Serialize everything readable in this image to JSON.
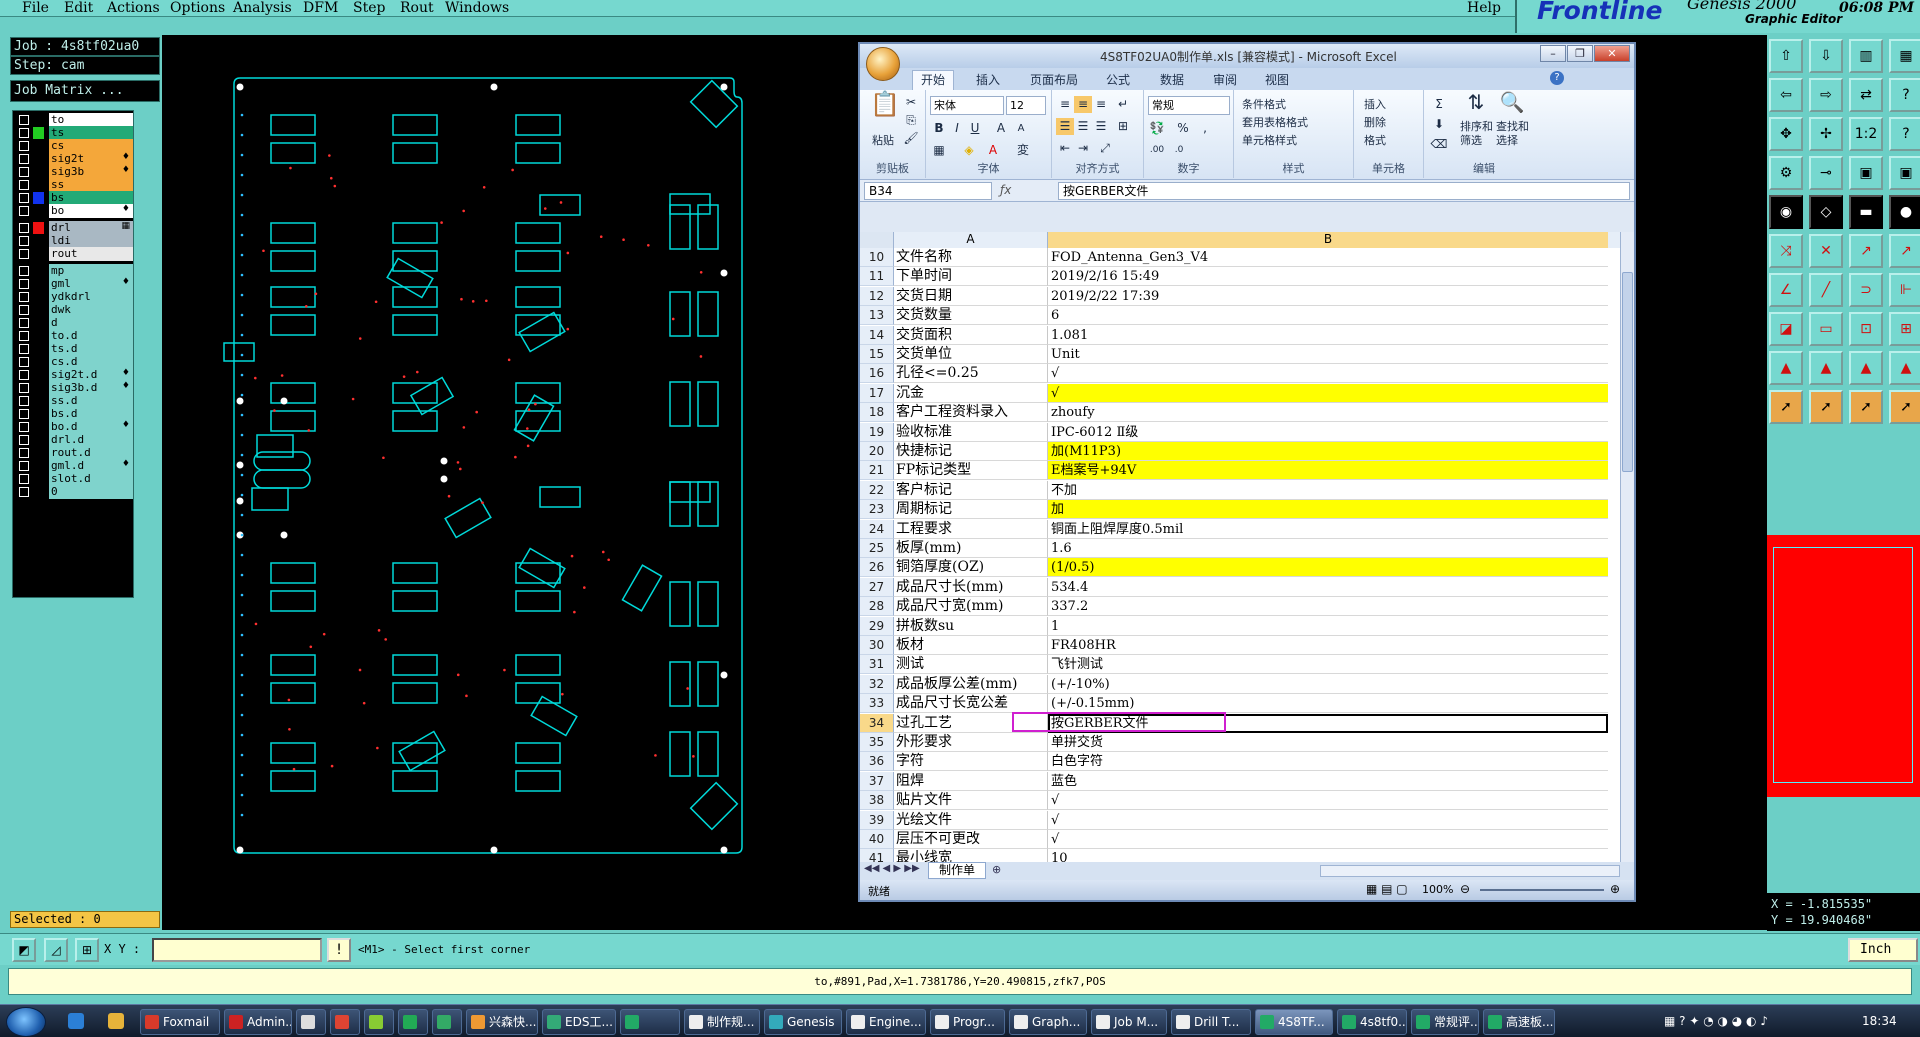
{
  "menubar": {
    "items": [
      "File",
      "Edit",
      "Actions",
      "Options",
      "Analysis",
      "DFM",
      "Step",
      "Rout",
      "Windows"
    ],
    "help": "Help"
  },
  "brand": {
    "logo": "Frontline",
    "title": "Genesis 2000",
    "subtitle": "Graphic Editor",
    "time": "06:08 PM"
  },
  "left_panel": {
    "job": "Job : 4s8tf02ua0",
    "step": "Step: cam",
    "job_matrix": "Job Matrix ...",
    "selected": "Selected : 0",
    "layers": [
      {
        "name": "to",
        "bg": "#ffffff",
        "sw": "#000000",
        "mark": ""
      },
      {
        "name": "ts",
        "bg": "#22aa77",
        "sw": "#22cc22",
        "mark": ""
      },
      {
        "name": "cs",
        "bg": "#f4a73a",
        "sw": "#000000",
        "mark": ""
      },
      {
        "name": "sig2t",
        "bg": "#f4a73a",
        "sw": "#000000",
        "mark": "♦"
      },
      {
        "name": "sig3b",
        "bg": "#f4a73a",
        "sw": "#000000",
        "mark": "♦"
      },
      {
        "name": "ss",
        "bg": "#f4a73a",
        "sw": "#000000",
        "mark": ""
      },
      {
        "name": "bs",
        "bg": "#22aa77",
        "sw": "#1133ee",
        "mark": ""
      },
      {
        "name": "bo",
        "bg": "#ffffff",
        "sw": "#000000",
        "mark": "♦"
      },
      {
        "name": "drl",
        "bg": "#a9b8c3",
        "sw": "#ee1111",
        "mark": "▦"
      },
      {
        "name": "ldi",
        "bg": "#a9b8c3",
        "sw": "#000000",
        "mark": ""
      },
      {
        "name": "rout",
        "bg": "#e8e8e8",
        "sw": "#000000",
        "mark": ""
      },
      {
        "name": "mp",
        "bg": "#7fd3cc",
        "sw": "#000000",
        "mark": ""
      },
      {
        "name": "gml",
        "bg": "#7fd3cc",
        "sw": "#000000",
        "mark": "♦"
      },
      {
        "name": "ydkdrl",
        "bg": "#7fd3cc",
        "sw": "#000000",
        "mark": ""
      },
      {
        "name": "dwk",
        "bg": "#7fd3cc",
        "sw": "#000000",
        "mark": ""
      },
      {
        "name": "d",
        "bg": "#7fd3cc",
        "sw": "#000000",
        "mark": ""
      },
      {
        "name": "to.d",
        "bg": "#7fd3cc",
        "sw": "#000000",
        "mark": ""
      },
      {
        "name": "ts.d",
        "bg": "#7fd3cc",
        "sw": "#000000",
        "mark": ""
      },
      {
        "name": "cs.d",
        "bg": "#7fd3cc",
        "sw": "#000000",
        "mark": ""
      },
      {
        "name": "sig2t.d",
        "bg": "#7fd3cc",
        "sw": "#000000",
        "mark": "♦"
      },
      {
        "name": "sig3b.d",
        "bg": "#7fd3cc",
        "sw": "#000000",
        "mark": "♦"
      },
      {
        "name": "ss.d",
        "bg": "#7fd3cc",
        "sw": "#000000",
        "mark": ""
      },
      {
        "name": "bs.d",
        "bg": "#7fd3cc",
        "sw": "#000000",
        "mark": ""
      },
      {
        "name": "bo.d",
        "bg": "#7fd3cc",
        "sw": "#000000",
        "mark": "♦"
      },
      {
        "name": "drl.d",
        "bg": "#7fd3cc",
        "sw": "#000000",
        "mark": ""
      },
      {
        "name": "rout.d",
        "bg": "#7fd3cc",
        "sw": "#000000",
        "mark": ""
      },
      {
        "name": "gml.d",
        "bg": "#7fd3cc",
        "sw": "#000000",
        "mark": "♦"
      },
      {
        "name": "slot.d",
        "bg": "#7fd3cc",
        "sw": "#000000",
        "mark": ""
      },
      {
        "name": "0",
        "bg": "#7fd3cc",
        "sw": "#000000",
        "mark": ""
      }
    ]
  },
  "excel": {
    "title": "4S8TF02UA0制作单.xls [兼容模式] - Microsoft Excel",
    "tabs": [
      "开始",
      "插入",
      "页面布局",
      "公式",
      "数据",
      "审阅",
      "视图"
    ],
    "ribbon": {
      "paste": "粘贴",
      "clipboard": "剪贴板",
      "font_name": "宋体",
      "font_size": "12",
      "font": "字体",
      "alignment": "对齐方式",
      "number_format": "常规",
      "number": "数字",
      "cond_format": "条件格式",
      "table_format": "套用表格格式",
      "cell_style": "单元格样式",
      "styles": "样式",
      "insert": "插入",
      "delete": "删除",
      "format": "格式",
      "cells": "单元格",
      "sort": "排序和\n筛选",
      "find": "查找和\n选择",
      "editing": "编辑"
    },
    "name_box": "B34",
    "formula": "按GERBER文件",
    "col_a": "A",
    "col_b": "B",
    "rows": [
      {
        "n": "10",
        "a": "文件名称",
        "b": "FOD_Antenna_Gen3_V4",
        "hl": false
      },
      {
        "n": "11",
        "a": "下单时间",
        "b": "2019/2/16 15:49",
        "hl": false
      },
      {
        "n": "12",
        "a": "交货日期",
        "b": "2019/2/22 17:39",
        "hl": false
      },
      {
        "n": "13",
        "a": "交货数量",
        "b": "6",
        "hl": false
      },
      {
        "n": "14",
        "a": "交货面积",
        "b": "1.081",
        "hl": false
      },
      {
        "n": "15",
        "a": "交货单位",
        "b": "Unit",
        "hl": false
      },
      {
        "n": "16",
        "a": "孔径<=0.25",
        "b": "√",
        "hl": false
      },
      {
        "n": "17",
        "a": "沉金",
        "b": "√",
        "hl": true
      },
      {
        "n": "18",
        "a": "客户工程资料录入",
        "b": "zhoufy",
        "hl": false
      },
      {
        "n": "19",
        "a": "验收标准",
        "b": "IPC-6012 Ⅱ级",
        "hl": false
      },
      {
        "n": "20",
        "a": "快捷标记",
        "b": "加(M11P3)",
        "hl": true
      },
      {
        "n": "21",
        "a": "FP标记类型",
        "b": "E档案号+94V",
        "hl": true
      },
      {
        "n": "22",
        "a": "客户标记",
        "b": "不加",
        "hl": false
      },
      {
        "n": "23",
        "a": "周期标记",
        "b": "加",
        "hl": true
      },
      {
        "n": "24",
        "a": "工程要求",
        "b": "铜面上阻焊厚度0.5mil",
        "hl": false
      },
      {
        "n": "25",
        "a": "板厚(mm)",
        "b": "1.6",
        "hl": false
      },
      {
        "n": "26",
        "a": "铜箔厚度(OZ)",
        "b": "(1/0.5)",
        "hl": true
      },
      {
        "n": "27",
        "a": "成品尺寸长(mm)",
        "b": "534.4",
        "hl": false
      },
      {
        "n": "28",
        "a": "成品尺寸宽(mm)",
        "b": "337.2",
        "hl": false
      },
      {
        "n": "29",
        "a": "拼板数su",
        "b": "1",
        "hl": false
      },
      {
        "n": "30",
        "a": "板材",
        "b": "FR408HR",
        "hl": false
      },
      {
        "n": "31",
        "a": "测试",
        "b": "飞针测试",
        "hl": false
      },
      {
        "n": "32",
        "a": "成品板厚公差(mm)",
        "b": "(+/-10%)",
        "hl": false
      },
      {
        "n": "33",
        "a": "成品尺寸长宽公差",
        "b": "(+/-0.15mm)",
        "hl": false
      },
      {
        "n": "34",
        "a": "过孔工艺",
        "b": "按GERBER文件",
        "hl": false
      },
      {
        "n": "35",
        "a": "外形要求",
        "b": "单拼交货",
        "hl": false
      },
      {
        "n": "36",
        "a": "字符",
        "b": "白色字符",
        "hl": false
      },
      {
        "n": "37",
        "a": "阻焊",
        "b": "蓝色",
        "hl": false
      },
      {
        "n": "38",
        "a": "贴片文件",
        "b": "√",
        "hl": false
      },
      {
        "n": "39",
        "a": "光绘文件",
        "b": "√",
        "hl": false
      },
      {
        "n": "40",
        "a": "层压不可更改",
        "b": "√",
        "hl": false
      },
      {
        "n": "41",
        "a": "最小线宽",
        "b": "10",
        "hl": false
      }
    ],
    "sheet_tab": "制作单",
    "status": "就绪",
    "zoom": "100%"
  },
  "coords": {
    "x": "X = -1.815535\"",
    "y": "Y = 19.940468\""
  },
  "cmd": {
    "xy_label": "X Y :",
    "prompt": "<M1> - Select first corner",
    "units": "Inch"
  },
  "info": "to,#891,Pad,X=1.7381786,Y=20.490815,zfk7,POS",
  "taskbar": {
    "tasks": [
      {
        "label": "Foxmail",
        "color": "#d83a2a",
        "active": false
      },
      {
        "label": "Admin...",
        "color": "#c22",
        "active": false
      },
      {
        "label": "",
        "color": "#ddd",
        "active": false
      },
      {
        "label": "",
        "color": "#d43",
        "active": false
      },
      {
        "label": "",
        "color": "#8c3",
        "active": false
      },
      {
        "label": "",
        "color": "#2a5",
        "active": false
      },
      {
        "label": "",
        "color": "#3a6",
        "active": false
      },
      {
        "label": "兴森快...",
        "color": "#e93",
        "active": false
      },
      {
        "label": "EDS工...",
        "color": "#3a7",
        "active": false
      },
      {
        "label": "",
        "color": "#2a6",
        "active": false
      },
      {
        "label": "制作规...",
        "color": "#eee",
        "active": false
      },
      {
        "label": "Genesis",
        "color": "#3ab",
        "active": false
      },
      {
        "label": "Engine...",
        "color": "#eee",
        "active": false
      },
      {
        "label": "Progr...",
        "color": "#eee",
        "active": false
      },
      {
        "label": "Graph...",
        "color": "#eee",
        "active": false
      },
      {
        "label": "Job M...",
        "color": "#eee",
        "active": false
      },
      {
        "label": "Drill T...",
        "color": "#eee",
        "active": false
      },
      {
        "label": "4S8TF...",
        "color": "#2a6",
        "active": true
      },
      {
        "label": "4s8tf0...",
        "color": "#2a6",
        "active": false
      },
      {
        "label": "常规评...",
        "color": "#2a6",
        "active": false
      },
      {
        "label": "高速板...",
        "color": "#2a6",
        "active": false
      }
    ],
    "clock": "18:34"
  }
}
